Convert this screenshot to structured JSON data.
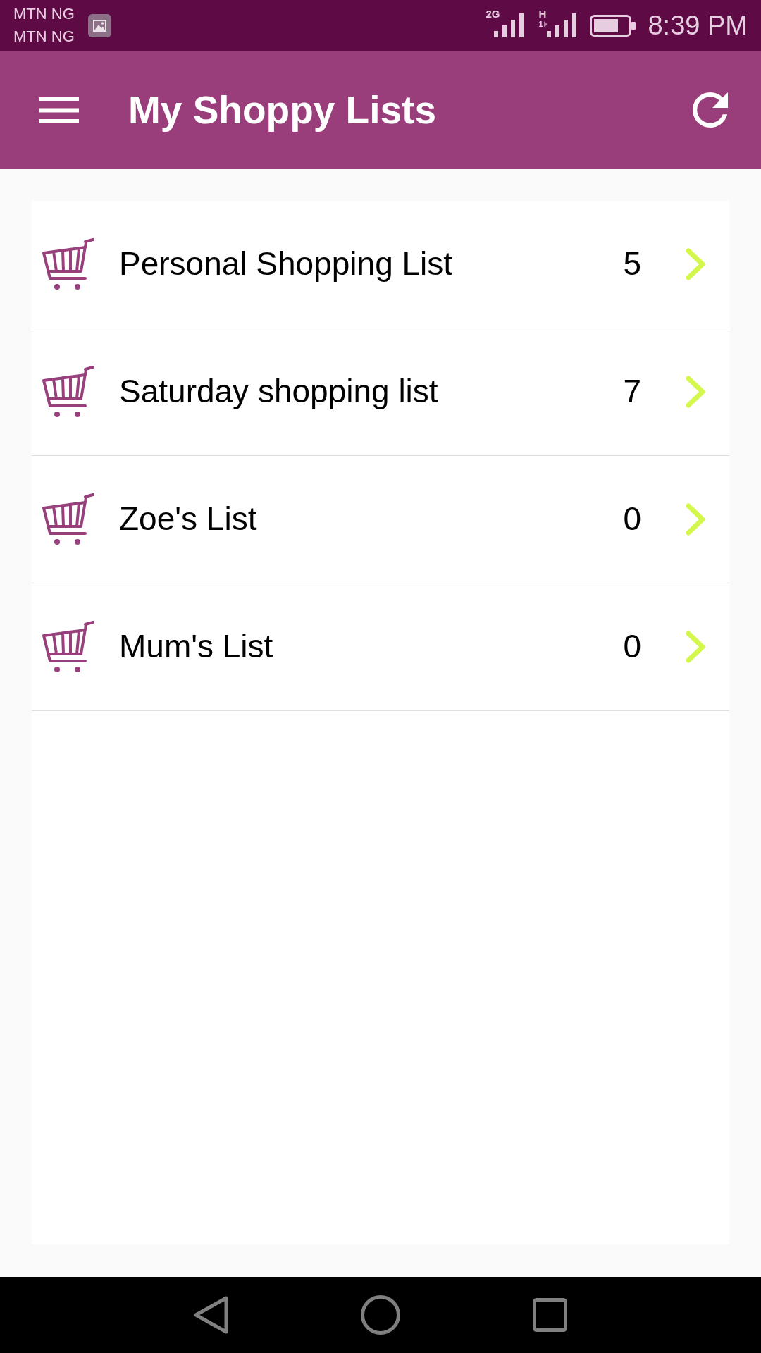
{
  "status_bar": {
    "carriers": [
      "MTN NG",
      "MTN NG"
    ],
    "signals": [
      {
        "network": "2G"
      },
      {
        "network": "H",
        "sim": "1"
      }
    ],
    "time": "8:39 PM"
  },
  "app_bar": {
    "title": "My Shoppy Lists"
  },
  "lists": [
    {
      "name": "Personal Shopping List",
      "count": "5"
    },
    {
      "name": "Saturday shopping list",
      "count": "7"
    },
    {
      "name": "Zoe's List",
      "count": "0"
    },
    {
      "name": "Mum's List",
      "count": "0"
    }
  ]
}
